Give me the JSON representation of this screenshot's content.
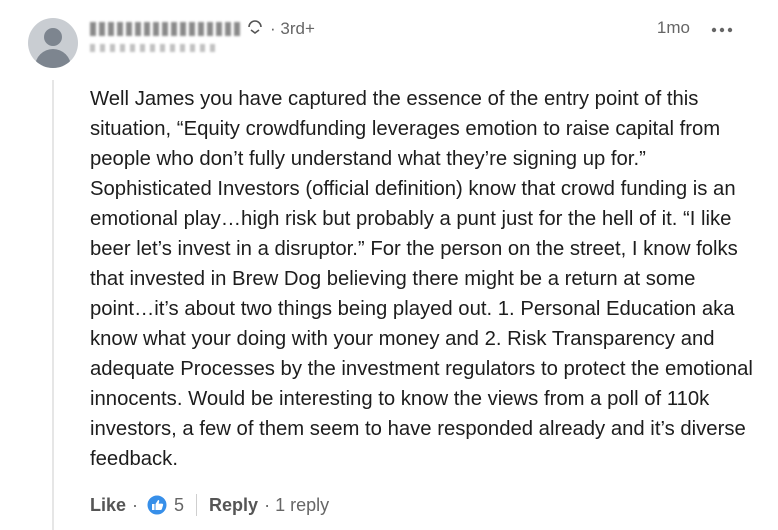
{
  "comment": {
    "author": {
      "name": "",
      "connection_degree": "· 3rd+",
      "headline": ""
    },
    "timestamp": "1mo",
    "more_icon": "more-horizontal-icon",
    "text": "Well James you have captured the essence of the entry point of this situation, “Equity crowdfunding leverages emotion to raise capital from people who don’t fully understand what they’re signing up for.” Sophisticated Investors (official definition) know that crowd funding is an emotional play…high risk but probably a punt just for the hell of it. “I like beer let’s invest in a disruptor.” For the person on the street, I know folks that invested in Brew Dog believing there might be a return at some point…it’s about two things being played out. 1. Personal Education aka know what your doing with your money and 2. Risk Transparency and adequate Processes by the investment regulators to protect the emotional innocents. Would be interesting to know the views from a poll of 110k investors, a few of them seem to have responded already and it’s diverse feedback.",
    "actions": {
      "like_label": "Like",
      "separator": "·",
      "reaction_icon": "like-reaction-icon",
      "reaction_count": "5",
      "reply_label": "Reply",
      "reply_count": "· 1 reply"
    }
  },
  "colors": {
    "reaction_blue": "#378fe9",
    "muted_text": "#666666",
    "body_text": "#1d1d1d",
    "thread_line": "#e6e6e6"
  }
}
